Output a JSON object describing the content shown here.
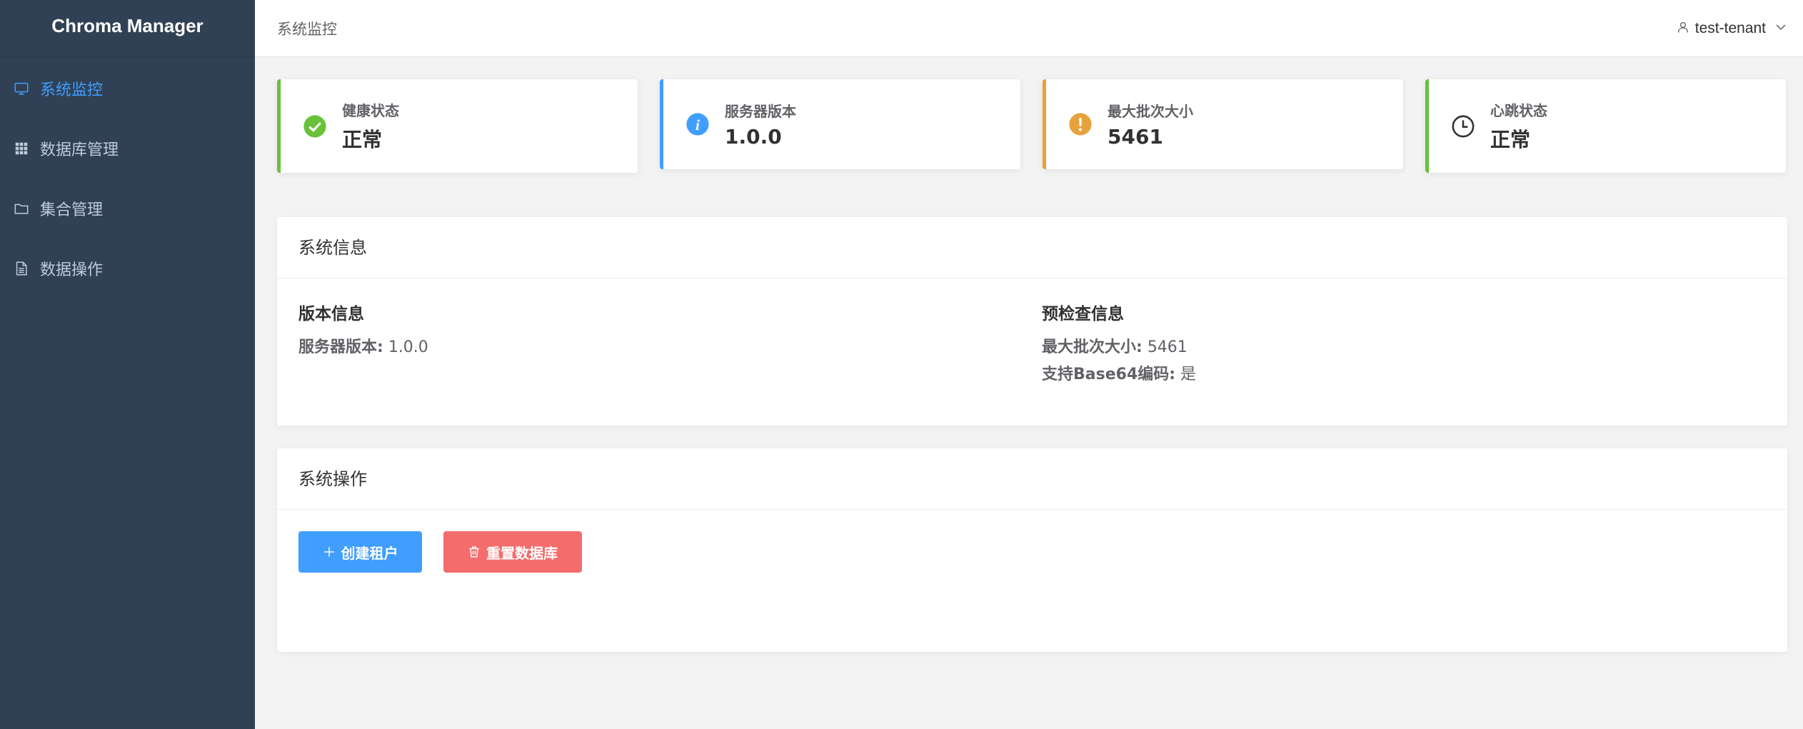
{
  "app": {
    "title": "Chroma Manager"
  },
  "sidebar": {
    "items": [
      {
        "label": "系统监控",
        "icon": "monitor-icon",
        "active": true
      },
      {
        "label": "数据库管理",
        "icon": "grid-icon",
        "active": false
      },
      {
        "label": "集合管理",
        "icon": "folder-icon",
        "active": false
      },
      {
        "label": "数据操作",
        "icon": "document-icon",
        "active": false
      }
    ]
  },
  "header": {
    "breadcrumb": "系统监控",
    "user": {
      "name": "test-tenant",
      "icon": "user-icon",
      "dropdown_icon": "chevron-down-icon"
    }
  },
  "stats": [
    {
      "label": "健康状态",
      "value": "正常",
      "icon": "check-circle-icon",
      "color": "#67c23a"
    },
    {
      "label": "服务器版本",
      "value": "1.0.0",
      "icon": "info-icon",
      "color": "#409eff"
    },
    {
      "label": "最大批次大小",
      "value": "5461",
      "icon": "warning-icon",
      "color": "#e6a23c"
    },
    {
      "label": "心跳状态",
      "value": "正常",
      "icon": "clock-icon",
      "color": "#67c23a"
    }
  ],
  "system_info": {
    "title": "系统信息",
    "version": {
      "title": "版本信息",
      "server_version_label": "服务器版本:",
      "server_version_value": "1.0.0"
    },
    "precheck": {
      "title": "预检查信息",
      "max_batch_label": "最大批次大小:",
      "max_batch_value": "5461",
      "base64_label": "支持Base64编码:",
      "base64_value": "是"
    }
  },
  "operations": {
    "title": "系统操作",
    "create_tenant_label": "创建租户",
    "reset_db_label": "重置数据库"
  },
  "colors": {
    "sidebar_bg": "#304156",
    "accent": "#409eff",
    "success": "#67c23a",
    "warning": "#e6a23c",
    "danger": "#f56c6c"
  }
}
